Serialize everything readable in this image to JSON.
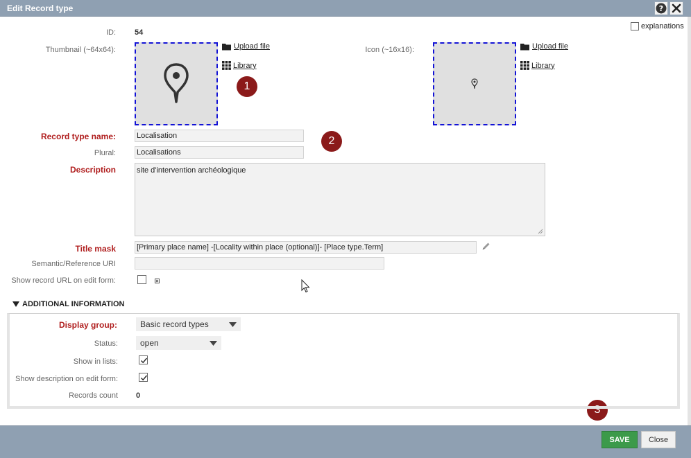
{
  "dialog": {
    "title": "Edit Record type"
  },
  "explanations_label": "explanations",
  "fields": {
    "id_label": "ID:",
    "id_value": "54",
    "thumbnail_label": "Thumbnail (~64x64):",
    "icon_label": "Icon (~16x16):",
    "upload_file": "Upload file",
    "library": "Library",
    "name_label": "Record type name:",
    "name_value": "Localisation",
    "plural_label": "Plural:",
    "plural_value": "Localisations",
    "description_label": "Description",
    "description_value": "site d'intervention archéologique",
    "title_mask_label": "Title mask",
    "title_mask_value": "[Primary place name] -[Locality within place (optional)]- [Place type.Term]",
    "uri_label": "Semantic/Reference URI",
    "uri_value": "",
    "show_url_label": "Show record URL on edit form:"
  },
  "additional": {
    "heading": "ADDITIONAL INFORMATION",
    "display_group_label": "Display group:",
    "display_group_value": "Basic record types",
    "status_label": "Status:",
    "status_value": "open",
    "show_in_lists_label": "Show in lists:",
    "show_in_lists_checked": true,
    "show_desc_label": "Show description on edit form:",
    "show_desc_checked": true,
    "records_count_label": "Records count",
    "records_count_value": "0"
  },
  "badges": [
    "1",
    "2",
    "3"
  ],
  "buttons": {
    "save": "SAVE",
    "close": "Close"
  },
  "colors": {
    "titlebar": "#8fa0b2",
    "required_label": "#b01e1e",
    "badge": "#8b1a1a",
    "save": "#3c9a4a",
    "dashed_border": "#1212d6"
  }
}
